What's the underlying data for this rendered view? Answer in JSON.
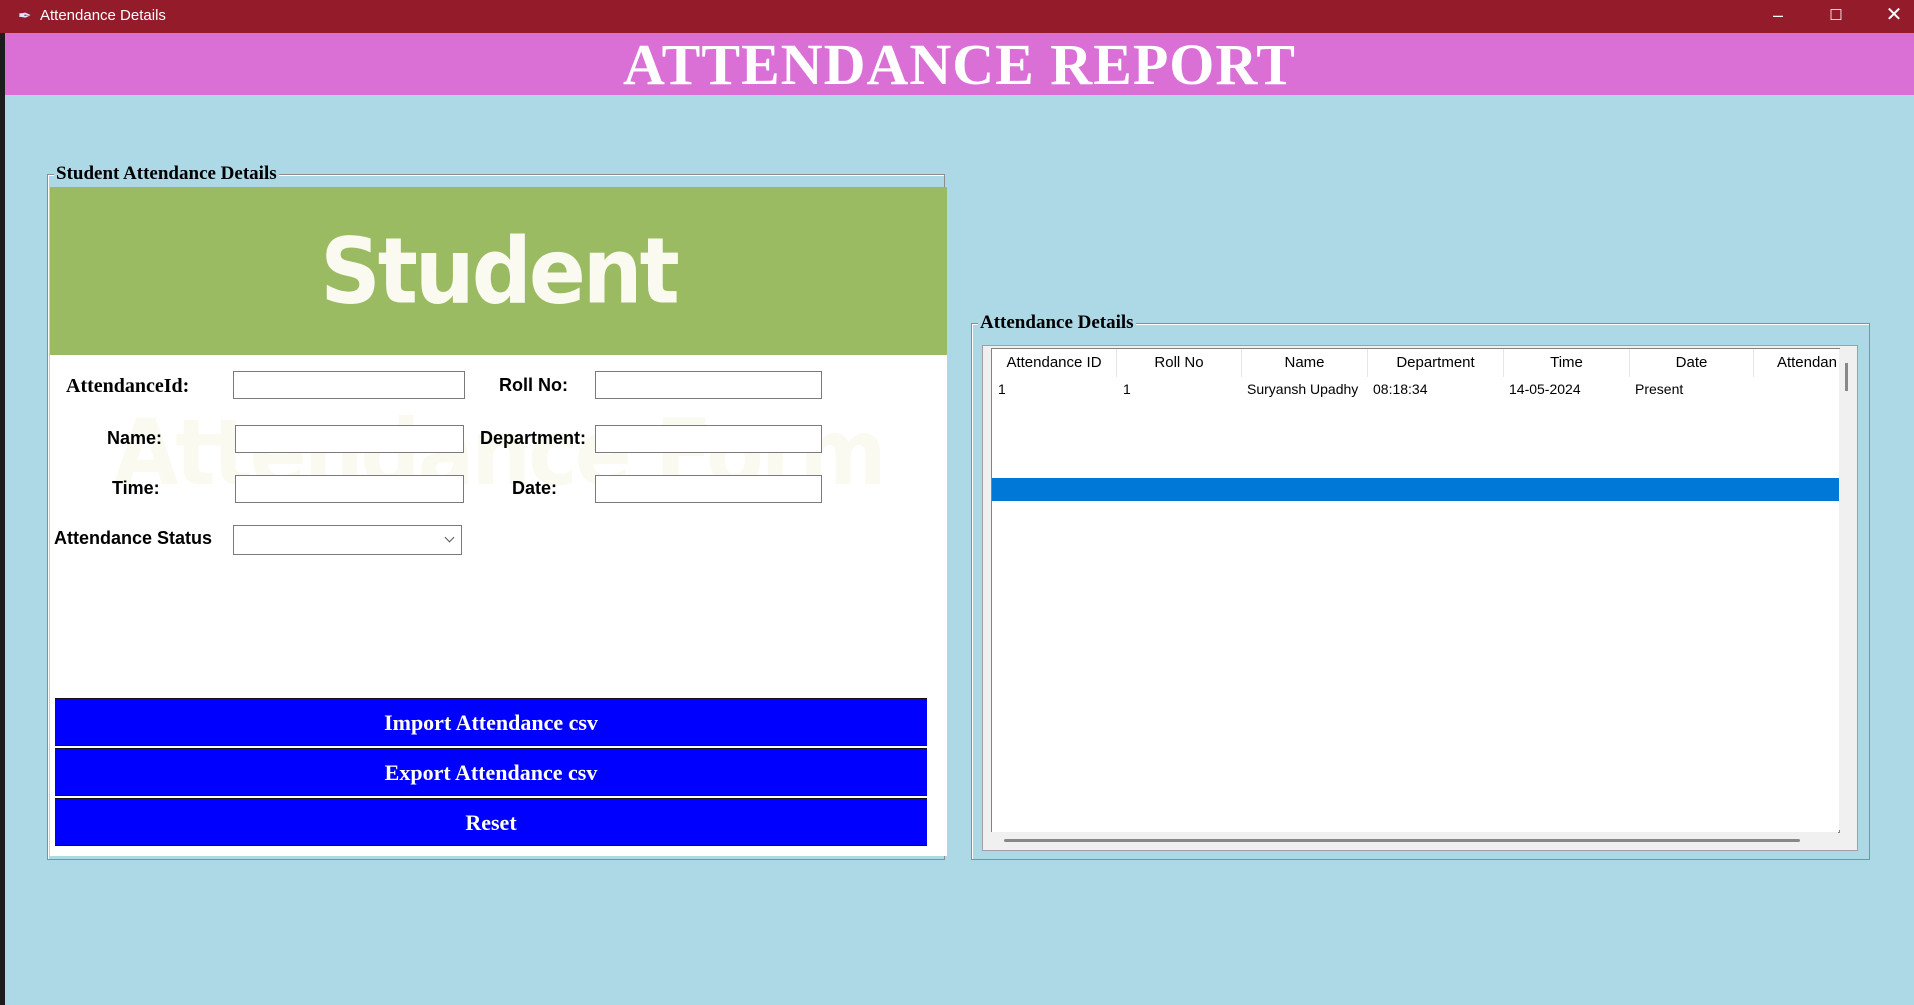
{
  "window": {
    "title": "Attendance Details",
    "app_icon": "feather-icon",
    "controls": {
      "minimize": "–",
      "maximize": "☐",
      "close": "✕"
    }
  },
  "header": {
    "title": "ATTENDANCE REPORT"
  },
  "colors": {
    "titlebar": "#931b2a",
    "header_bg": "#da70d6",
    "background": "#add8e6",
    "banner_bg": "#9bbb62",
    "button_bg": "#0000ff",
    "selection": "#0078d7"
  },
  "student_frame": {
    "legend": "Student Attendance Details",
    "banner_text": "Student Attendance Form",
    "labels": {
      "attendance_id": "AttendanceId:",
      "roll_no": "Roll No:",
      "name": "Name:",
      "department": "Department:",
      "time": "Time:",
      "date": "Date:",
      "attendance_status": "Attendance Status"
    },
    "values": {
      "attendance_id": "",
      "roll_no": "",
      "name": "",
      "department": "",
      "time": "",
      "date": "",
      "attendance_status": ""
    },
    "buttons": {
      "import": "Import Attendance csv",
      "export": "Export Attendance csv",
      "reset": "Reset"
    }
  },
  "details_frame": {
    "legend": "Attendance Details",
    "columns": [
      "Attendance ID",
      "Roll No",
      "Name",
      "Department",
      "Time",
      "Date",
      "Attendan"
    ],
    "rows": [
      [
        "1",
        "1",
        "Suryansh Upadhy",
        "08:18:34",
        "14-05-2024",
        "Present"
      ]
    ]
  }
}
